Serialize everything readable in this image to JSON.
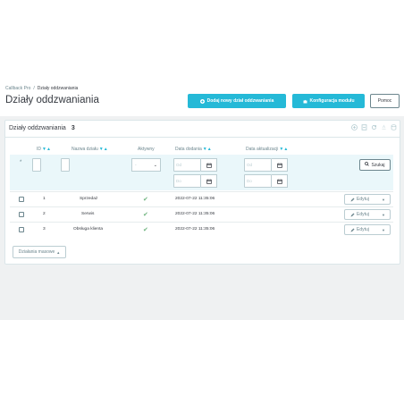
{
  "breadcrumb": {
    "parent": "Callback Pro",
    "separator": "/",
    "current": "Działy oddzwaniania"
  },
  "page_title": "Działy oddzwaniania",
  "toolbar": {
    "add_department_label": "Dodaj nowy dział oddzwaniania",
    "module_config_label": "Konfiguracja modułu",
    "help_label": "Pomoc"
  },
  "panel": {
    "title": "Działy oddzwaniania",
    "count": "3",
    "tools": [
      "plus-circle-icon",
      "export-icon",
      "refresh-icon",
      "sql-query-icon",
      "database-icon"
    ]
  },
  "table": {
    "columns": {
      "id": "ID",
      "name": "Nazwa działu",
      "active": "Aktywny",
      "date_add": "Data dodania",
      "date_upd": "Data aktualizacji"
    },
    "sort_arrows": "▼▲",
    "filters": {
      "active_select": "-",
      "date_from_placeholder": "Od",
      "date_to_placeholder": "Do",
      "star": "*",
      "search_label": "Szukaj"
    },
    "rows": [
      {
        "id": "1",
        "name": "Sprzedaż",
        "active": "✔",
        "date_add": "2022-07-22 11:35:06",
        "date_upd": "",
        "edit": "Edytuj"
      },
      {
        "id": "2",
        "name": "Serwis",
        "active": "✔",
        "date_add": "2022-07-22 11:35:06",
        "date_upd": "",
        "edit": "Edytuj"
      },
      {
        "id": "3",
        "name": "Obsługa klienta",
        "active": "✔",
        "date_add": "2022-07-22 11:35:06",
        "date_upd": "",
        "edit": "Edytuj"
      }
    ],
    "bulk_actions_label": "Działania masowe"
  },
  "colors": {
    "accent": "#25b9d7",
    "success": "#70b580",
    "border": "#bbcdd2",
    "background": "#eff1f2"
  }
}
